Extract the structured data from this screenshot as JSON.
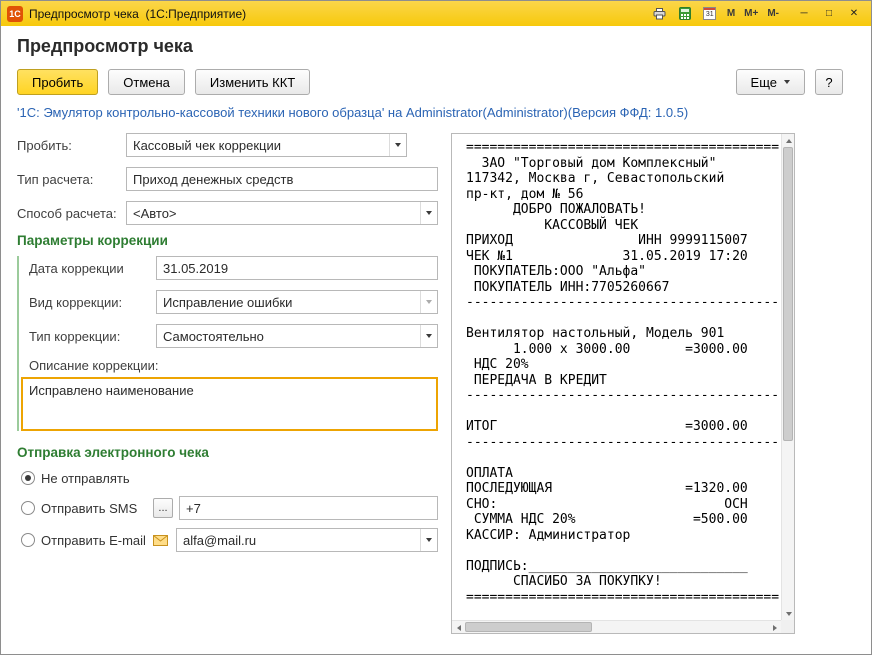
{
  "titlebar": {
    "logo_text": "1С",
    "title": "Предпросмотр чека  (1С:Предприятие)",
    "calendar_day": "31",
    "memory_labels": [
      "M",
      "M+",
      "M-"
    ],
    "minimize_glyph": "─",
    "maximize_glyph": "□",
    "close_glyph": "✕"
  },
  "page": {
    "title": "Предпросмотр чека",
    "device_info": "'1С: Эмулятор контрольно-кассовой техники нового образца' на Administrator(Administrator)(Версия ФФД: 1.0.5)"
  },
  "toolbar": {
    "post": "Пробить",
    "cancel": "Отмена",
    "change_kkt": "Изменить ККТ",
    "more": "Еще",
    "help": "?"
  },
  "form": {
    "post": {
      "label": "Пробить:",
      "value": "Кассовый чек коррекции"
    },
    "calc_type": {
      "label": "Тип расчета:",
      "value": "Приход денежных средств"
    },
    "calc_method": {
      "label": "Способ расчета:",
      "value": "<Авто>"
    },
    "correction_section": "Параметры коррекции",
    "correction_date": {
      "label": "Дата коррекции",
      "value": "31.05.2019"
    },
    "correction_kind": {
      "label": "Вид коррекции:",
      "value": "Исправление ошибки"
    },
    "correction_type": {
      "label": "Тип коррекции:",
      "value": "Самостоятельно"
    },
    "correction_note": {
      "label": "Описание коррекции:",
      "value": "Исправлено наименование"
    },
    "send_section": "Отправка электронного чека",
    "send_none": {
      "label": "Не отправлять",
      "selected": true
    },
    "send_sms": {
      "label": "Отправить SMS",
      "selected": false,
      "picker": "...",
      "value": "+7"
    },
    "send_email": {
      "label": "Отправить E-mail",
      "selected": false,
      "value": "alfa@mail.ru"
    }
  },
  "receipt": {
    "lines": [
      "========================================",
      "  ЗАО \"Торговый дом Комплексный\"",
      "117342, Москва г, Севастопольский",
      "пр-кт, дом № 56",
      "      ДОБРО ПОЖАЛОВАТЬ!",
      "          КАССОВЫЙ ЧЕК",
      "ПРИХОД                ИНН 9999115007",
      "ЧЕК №1              31.05.2019 17:20",
      " ПОКУПАТЕЛЬ:ООО \"Альфа\"",
      " ПОКУПАТЕЛЬ ИНН:7705260667",
      "----------------------------------------",
      "",
      "Вентилятор настольный, Модель 901",
      "      1.000 х 3000.00       =3000.00",
      " НДС 20%",
      " ПЕРЕДАЧА В КРЕДИТ",
      "----------------------------------------",
      "",
      "ИТОГ                        =3000.00",
      "----------------------------------------",
      "",
      "ОПЛАТА",
      "ПОСЛЕДУЮЩАЯ                 =1320.00",
      "СНО:                             ОСН",
      " СУММА НДС 20%               =500.00",
      "КАССИР: Администратор",
      "",
      "ПОДПИСЬ:____________________________",
      "      СПАСИБО ЗА ПОКУПКУ!",
      "========================================"
    ]
  }
}
